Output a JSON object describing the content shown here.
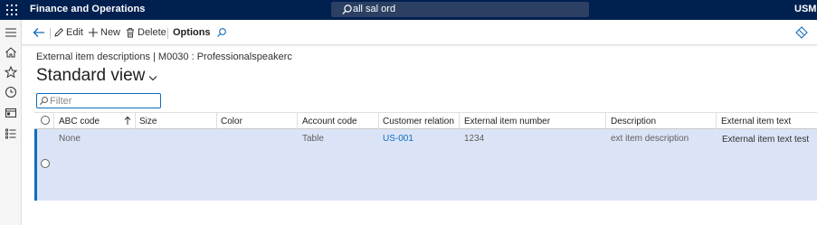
{
  "topbar": {
    "app_title": "Finance and Operations",
    "search_text": "all sal ord",
    "company": "USMF"
  },
  "leftnav": {
    "items": [
      "menu-icon",
      "home-icon",
      "star-icon",
      "clock-icon",
      "workspace-icon",
      "list-icon"
    ]
  },
  "actionpane": {
    "edit_label": "Edit",
    "new_label": "New",
    "delete_label": "Delete",
    "options_label": "Options"
  },
  "page": {
    "breadcrumb": "External item descriptions  |  M0030 : Professionalspeakerc",
    "view_title": "Standard view",
    "filter_placeholder": "Filter"
  },
  "grid": {
    "columns": {
      "abc_code": "ABC code",
      "size": "Size",
      "color": "Color",
      "account_code": "Account code",
      "customer_relation": "Customer relation",
      "external_item_number": "External item number",
      "description": "Description",
      "external_item_text": "External item text"
    },
    "rows": [
      {
        "abc_code": "None",
        "size": "",
        "color": "",
        "account_code": "Table",
        "customer_relation": "US-001",
        "external_item_number": "1234",
        "description": "ext item description",
        "external_item_text": "External item text test"
      },
      {
        "abc_code": "",
        "size": "",
        "color": "",
        "account_code": "",
        "customer_relation": "",
        "external_item_number": "",
        "description": "",
        "external_item_text": ""
      }
    ]
  },
  "colors": {
    "topbar_bg": "#002050",
    "accent": "#0f6cbd",
    "selected_row_bg": "#dbe4f7"
  }
}
